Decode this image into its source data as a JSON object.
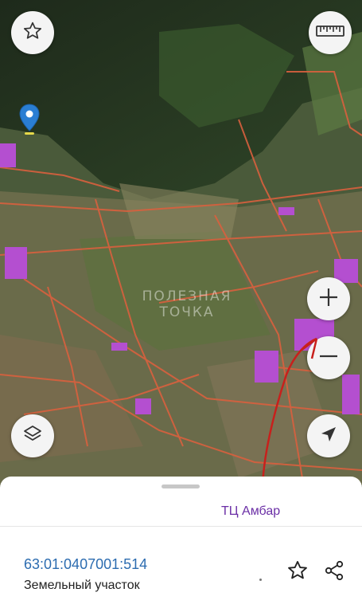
{
  "map": {
    "watermark_line1": "ПОЛЕЗНАЯ",
    "watermark_line2": "ТОЧКА",
    "controls": {
      "favorite_icon": "star-icon",
      "ruler_icon": "ruler-icon",
      "zoom_in_icon": "plus-icon",
      "zoom_out_icon": "minus-icon",
      "layers_icon": "layers-icon",
      "locate_icon": "navigation-arrow-icon"
    },
    "parcel_line_color": "#d9603e",
    "highlight_color": "#b44fd0"
  },
  "annotation": {
    "label": "ТЦ Амбар",
    "color": "#6b2fa6",
    "arrow_color": "#c8201c"
  },
  "sheet": {
    "cadastral_number": "63:01:0407001:514",
    "object_type": "Земельный участок",
    "actions": [
      "star-outline-icon",
      "share-icon"
    ]
  }
}
